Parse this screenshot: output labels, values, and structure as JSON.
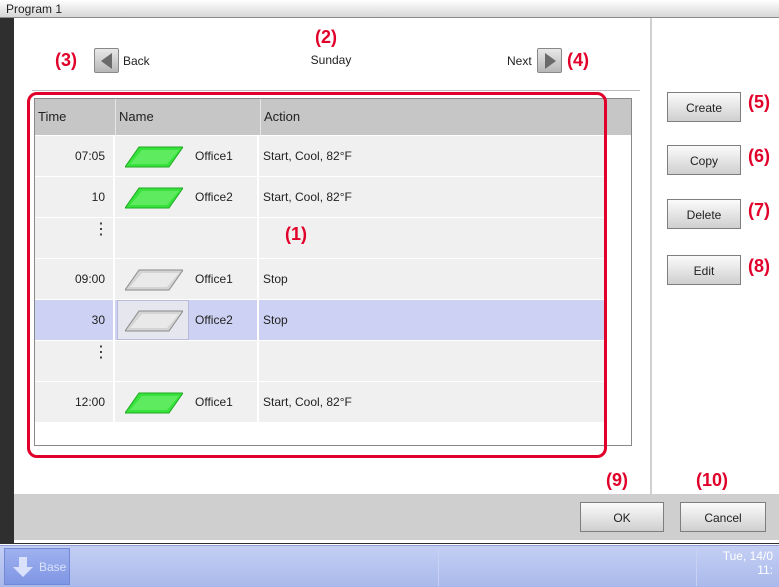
{
  "window": {
    "title": "Program 1"
  },
  "navigation": {
    "back_label": "Back",
    "next_label": "Next",
    "day": "Sunday"
  },
  "annotations": {
    "n1": "(1)",
    "n2": "(2)",
    "n3": "(3)",
    "n4": "(4)",
    "n5": "(5)",
    "n6": "(6)",
    "n7": "(7)",
    "n8": "(8)",
    "n9": "(9)",
    "n10": "(10)"
  },
  "table": {
    "headers": {
      "time": "Time",
      "name": "Name",
      "action": "Action"
    },
    "rows": [
      {
        "time": "07:05",
        "name": "Office1",
        "action": "Start, Cool, 82°F",
        "unit_state": "on"
      },
      {
        "time": "10",
        "name": "Office2",
        "action": "Start, Cool, 82°F",
        "unit_state": "on"
      },
      {
        "ellipsis": "⋮"
      },
      {
        "time": "09:00",
        "name": "Office1",
        "action": "Stop",
        "unit_state": "off"
      },
      {
        "time": "30",
        "name": "Office2",
        "action": "Stop",
        "unit_state": "off",
        "selected": true
      },
      {
        "ellipsis": "⋮"
      },
      {
        "time": "12:00",
        "name": "Office1",
        "action": "Start, Cool, 82°F",
        "unit_state": "on"
      }
    ]
  },
  "side_buttons": {
    "create": "Create",
    "copy": "Copy",
    "delete": "Delete",
    "edit": "Edit"
  },
  "footer_buttons": {
    "ok": "OK",
    "cancel": "Cancel"
  },
  "taskbar": {
    "base_label": "Base",
    "datetime_line1": "Tue, 14/0",
    "datetime_line2": "11:"
  },
  "colors": {
    "annotation_red": "#e0002a",
    "unit_on_green": "#38e23c",
    "unit_off_gray": "#d4d4d4",
    "selected_row": "#cdd1f3",
    "taskbar_blue": "#aab9ec"
  }
}
